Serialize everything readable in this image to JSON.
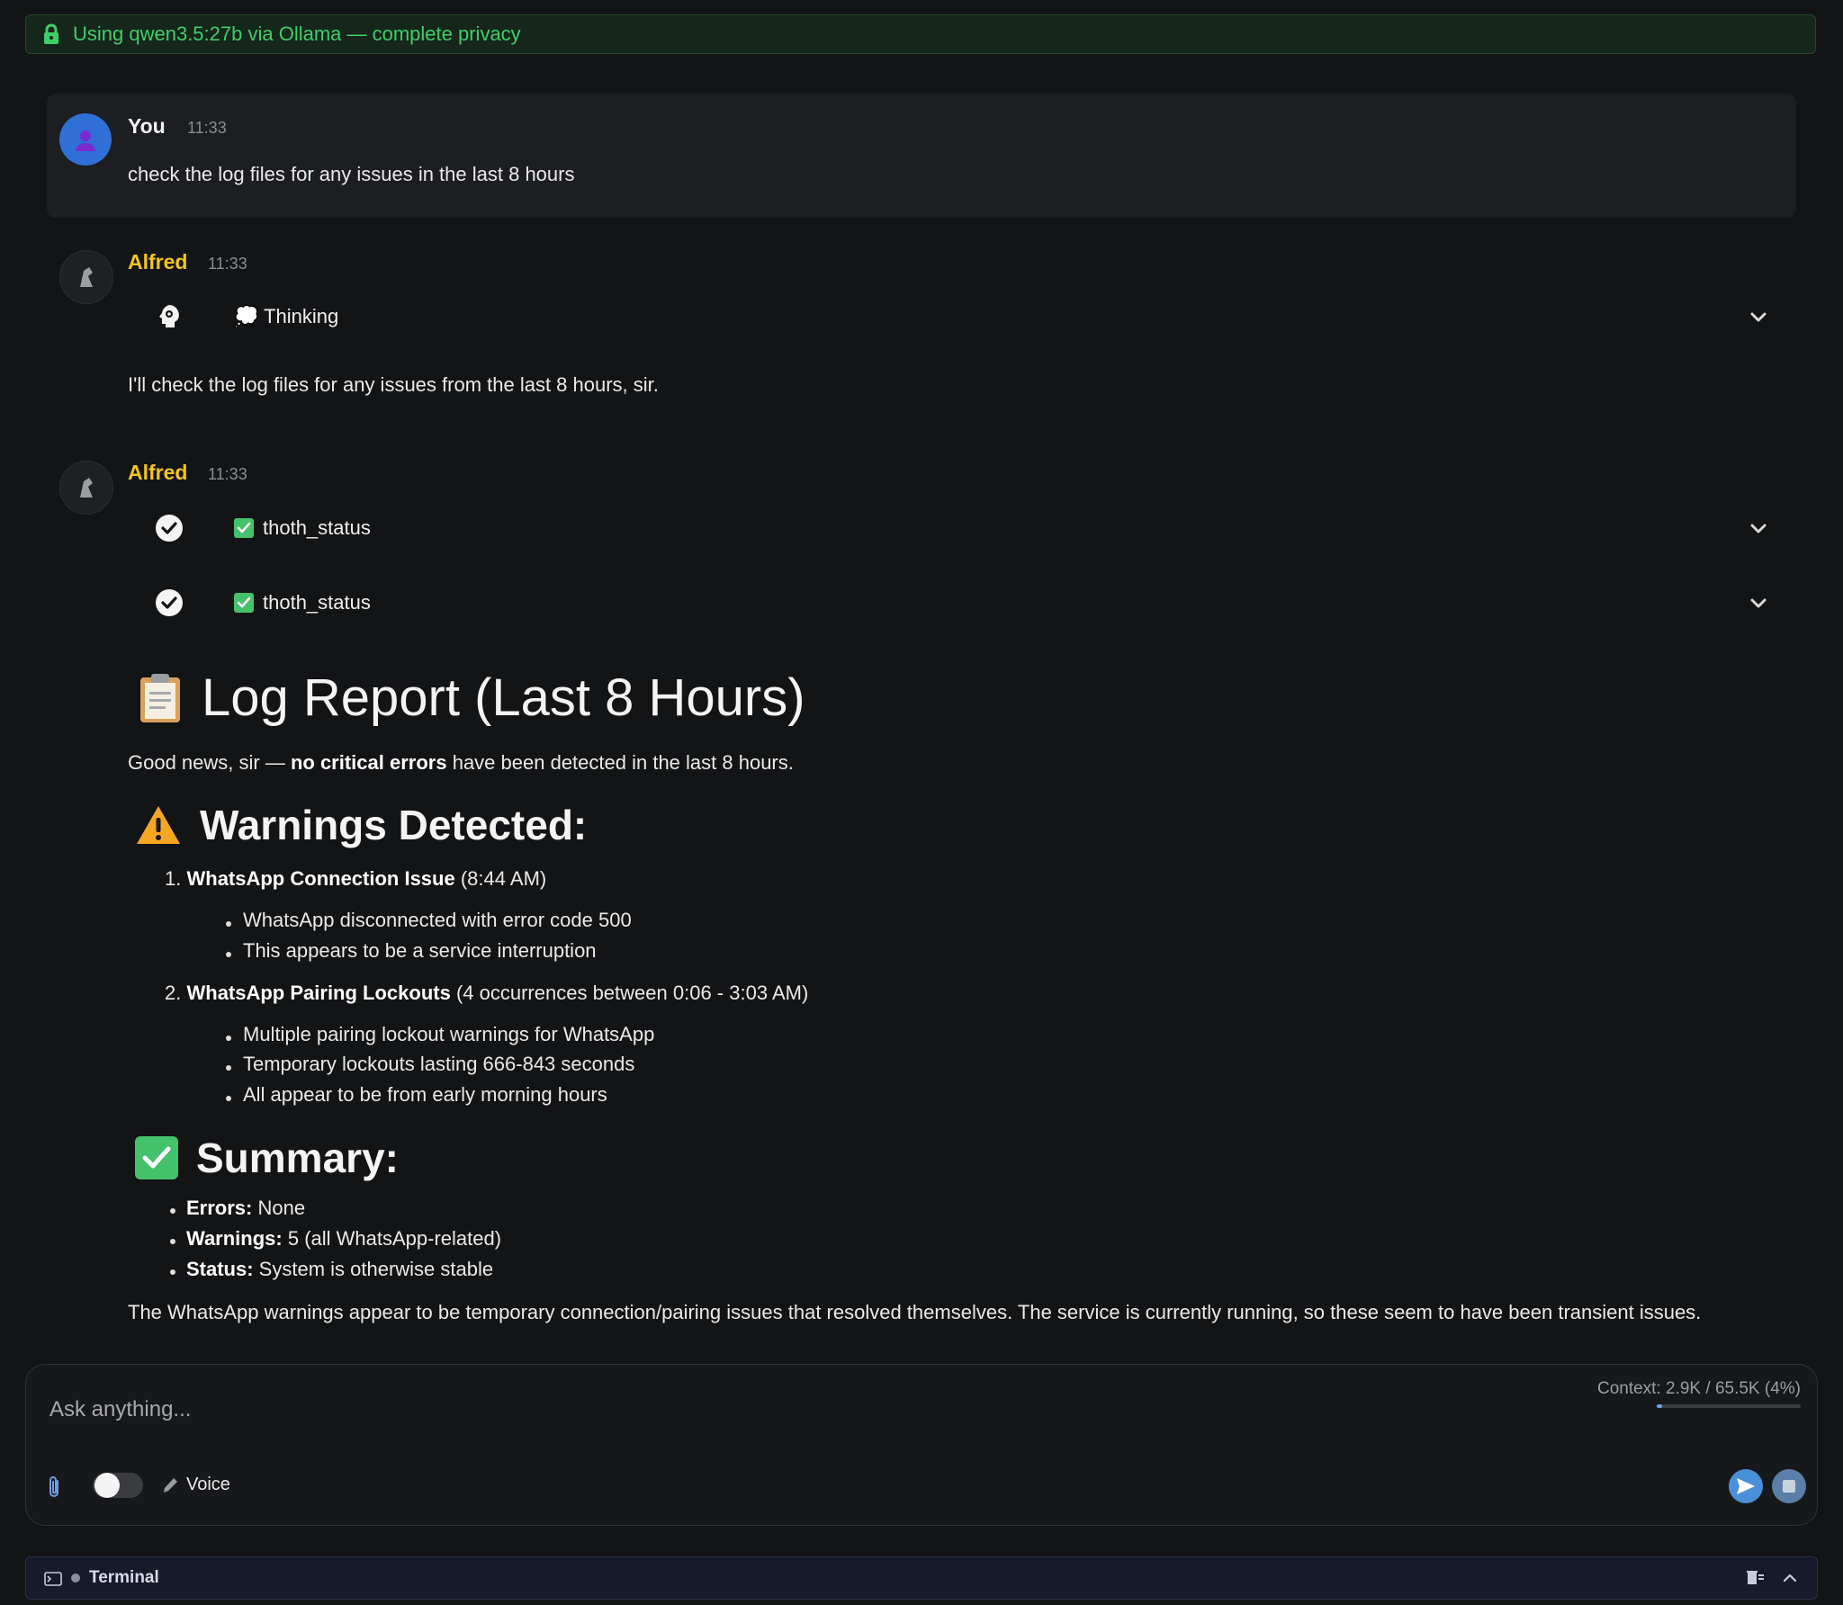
{
  "banner": {
    "text": "Using qwen3.5:27b via Ollama — complete privacy",
    "icon": "lock-icon",
    "color": "#3fcf6a"
  },
  "messages": {
    "user": {
      "name": "You",
      "time": "11:33",
      "text": "check the log files for any issues in the last 8 hours"
    },
    "alfred1": {
      "name": "Alfred",
      "time": "11:33",
      "thinking_label": "💭 Thinking",
      "text": "I'll check the log files for any issues from the last 8 hours, sir."
    },
    "alfred2": {
      "name": "Alfred",
      "time": "11:33",
      "tools": [
        {
          "label": "thoth_status",
          "status": "done"
        },
        {
          "label": "thoth_status",
          "status": "done"
        }
      ],
      "report": {
        "title": "Log Report (Last 8 Hours)",
        "intro_pre": "Good news, sir — ",
        "intro_bold": "no critical errors",
        "intro_post": " have been detected in the last 8 hours.",
        "warnings_heading": "Warnings Detected:",
        "warnings": [
          {
            "num": "1.",
            "title": "WhatsApp Connection Issue",
            "detail": " (8:44 AM)",
            "bullets": [
              "WhatsApp disconnected with error code 500",
              "This appears to be a service interruption"
            ]
          },
          {
            "num": "2.",
            "title": "WhatsApp Pairing Lockouts",
            "detail": " (4 occurrences between 0:06 - 3:03 AM)",
            "bullets": [
              "Multiple pairing lockout warnings for WhatsApp",
              "Temporary lockouts lasting 666-843 seconds",
              "All appear to be from early morning hours"
            ]
          }
        ],
        "summary_heading": "Summary:",
        "summary": [
          {
            "key": "Errors:",
            "value": " None"
          },
          {
            "key": "Warnings:",
            "value": " 5 (all WhatsApp-related)"
          },
          {
            "key": "Status:",
            "value": " System is otherwise stable"
          }
        ],
        "closing": "The WhatsApp warnings appear to be temporary connection/pairing issues that resolved themselves. The service is currently running, so these seem to have been transient issues."
      }
    }
  },
  "composer": {
    "placeholder": "Ask anything...",
    "context_label": "Context: 2.9K / 65.5K (4%)",
    "context_fraction": 0.04,
    "voice_label": "Voice",
    "voice_toggle_on": false
  },
  "terminal": {
    "label": "Terminal"
  },
  "colors": {
    "accent_name": "#f5c518",
    "background": "#131416",
    "send": "#4a90d9"
  }
}
